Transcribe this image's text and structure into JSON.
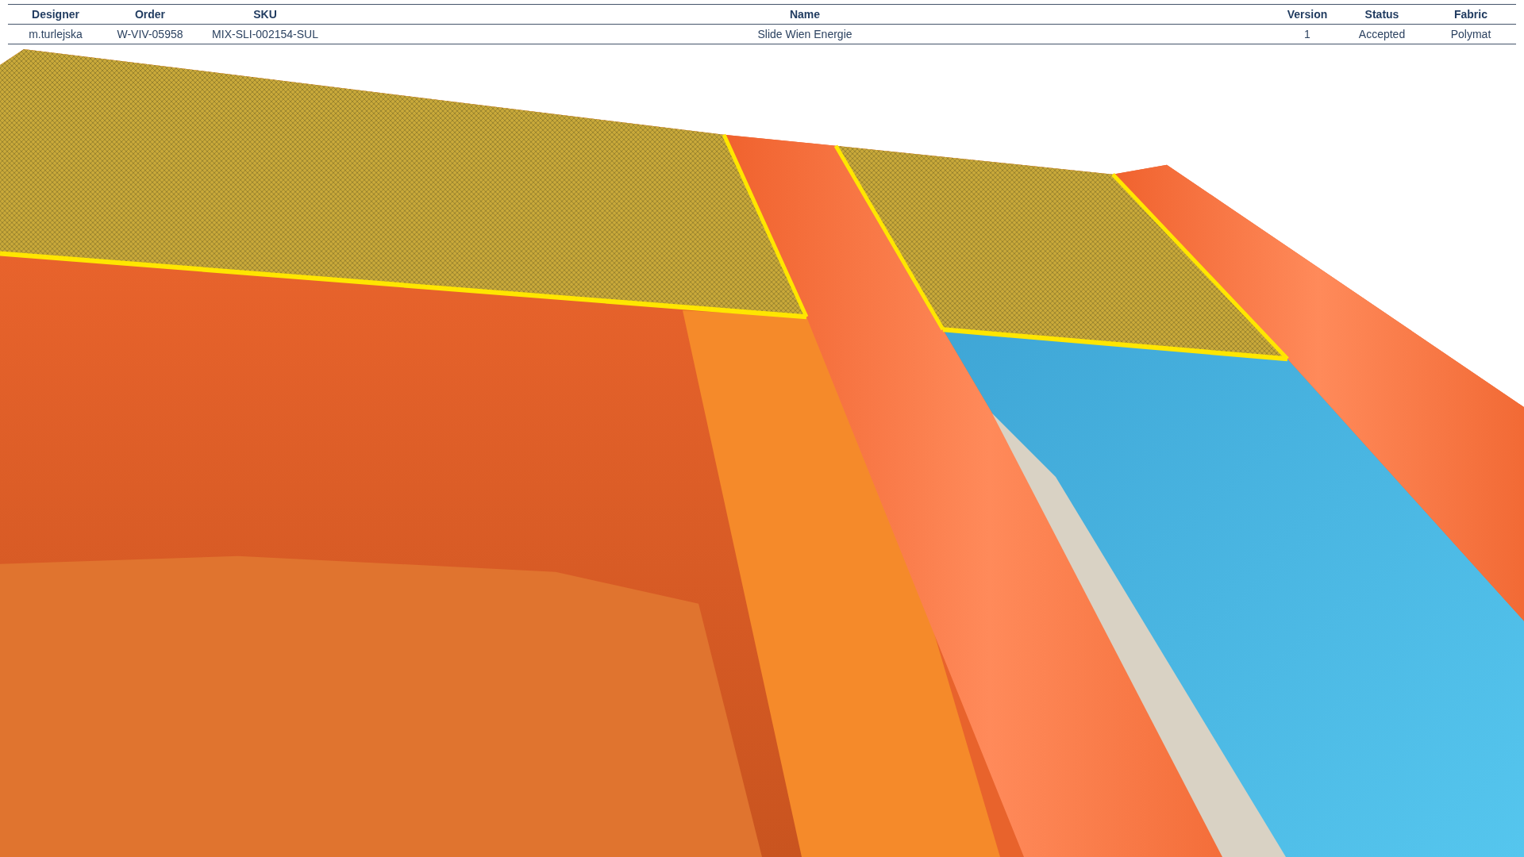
{
  "table": {
    "columns": [
      "Designer",
      "Order",
      "SKU",
      "Name",
      "Version",
      "Status",
      "Fabric"
    ],
    "rows": [
      [
        "m.turlejska",
        "W-VIV-05958",
        "MIX-SLI-002154-SUL",
        "Slide Wien Energie",
        "1",
        "Accepted",
        "Polymat"
      ]
    ]
  }
}
